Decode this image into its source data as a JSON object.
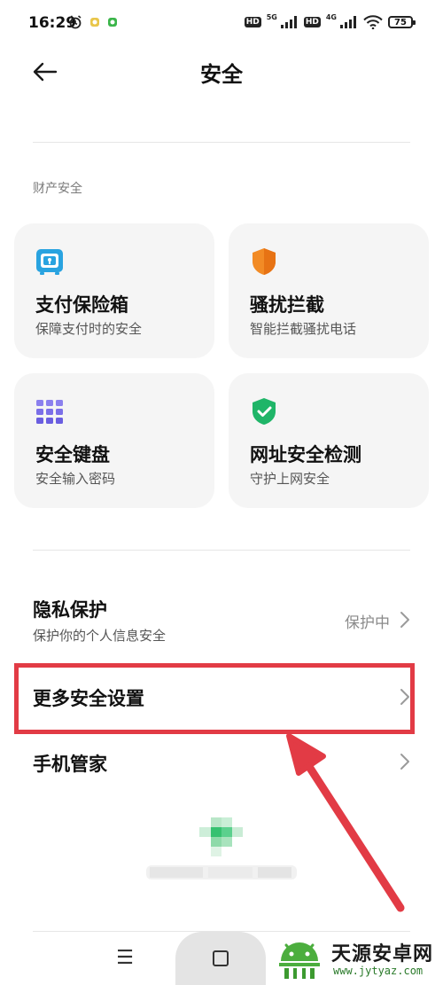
{
  "status_bar": {
    "time": "16:29",
    "hd1": "HD",
    "net1": "5G",
    "hd2": "HD",
    "net2": "4G",
    "battery": "75"
  },
  "header": {
    "title": "安全"
  },
  "section": {
    "label": "财产安全"
  },
  "cards": [
    {
      "title": "支付保险箱",
      "subtitle": "保障支付时的安全",
      "icon": "safe-box-icon",
      "color": "#29a3e0"
    },
    {
      "title": "骚扰拦截",
      "subtitle": "智能拦截骚扰电话",
      "icon": "shield-icon",
      "color": "#f28b25"
    },
    {
      "title": "安全键盘",
      "subtitle": "安全输入密码",
      "icon": "keypad-grid-icon",
      "color": "#7b6fe8"
    },
    {
      "title": "网址安全检测",
      "subtitle": "守护上网安全",
      "icon": "shield-check-icon",
      "color": "#1fb568"
    }
  ],
  "list": {
    "privacy": {
      "title": "隐私保护",
      "subtitle": "保护你的个人信息安全",
      "value": "保护中"
    },
    "more_security": {
      "title": "更多安全设置"
    },
    "phone_manager": {
      "title": "手机管家"
    }
  },
  "nav": {
    "menu_glyph": "☰"
  },
  "watermark": {
    "text": "天源安卓网",
    "url": "www.jytyaz.com"
  },
  "colors": {
    "accent_highlight": "#e23b45"
  }
}
